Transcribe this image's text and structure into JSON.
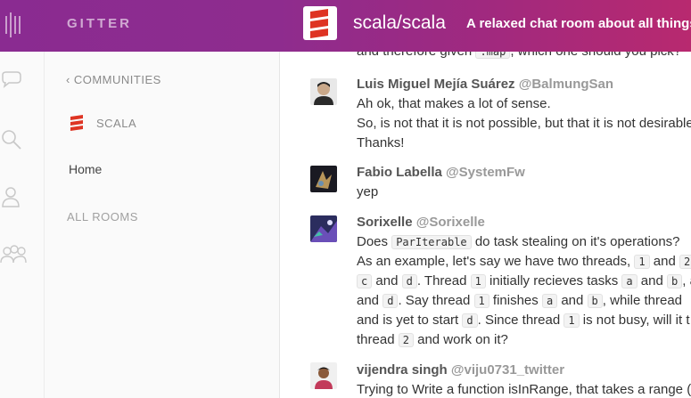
{
  "header": {
    "app_name": "GITTER",
    "room_name": "scala/scala",
    "room_topic": "A relaxed chat room about all things S"
  },
  "panel": {
    "back_label": "COMMUNITIES",
    "community_name": "SCALA",
    "home_label": "Home",
    "all_rooms_label": "ALL ROOMS"
  },
  "messages": {
    "partial": {
      "text_a": "and therefore given ",
      "code": ".map",
      "text_b": ", which one should you pick?"
    },
    "m1": {
      "name": "Luis Miguel Mejía Suárez",
      "user": "@BalmungSan",
      "lines": [
        "Ah ok, that makes a lot of sense.",
        "So, is not that it is not possible, but that it is not desirable",
        "Thanks!"
      ]
    },
    "m2": {
      "name": "Fabio Labella",
      "user": "@SystemFw",
      "lines": [
        "yep"
      ]
    },
    "m3": {
      "name": "Sorixelle",
      "user": "@Sorixelle",
      "l1": {
        "a": "Does ",
        "c1": "ParIterable",
        "b": " do task stealing on it's operations?"
      },
      "l2": {
        "a": "As an example, let's say we have two threads, ",
        "c1": "1",
        "b": " and ",
        "c2": "2"
      },
      "l3": {
        "c1": "c",
        "a": " and ",
        "c2": "d",
        "b": ". Thread ",
        "c3": "1",
        "c": " initially recieves tasks ",
        "c4": "a",
        "d": " and ",
        "c5": "b",
        "e": ", a"
      },
      "l4": {
        "a": "and ",
        "c1": "d",
        "b": ". Say thread ",
        "c2": "1",
        "c": " finishes ",
        "c3": "a",
        "d": " and ",
        "c4": "b",
        "e": ", while thread "
      },
      "l5": {
        "a": "and is yet to start ",
        "c1": "d",
        "b": ". Since thread ",
        "c2": "1",
        "c": " is not busy, will it t"
      },
      "l6": {
        "a": "thread ",
        "c1": "2",
        "b": " and work on it?"
      }
    },
    "m4": {
      "name": "vijendra singh",
      "user": "@viju0731_twitter",
      "lines": [
        "Trying to Write a function isInRange, that takes a range (f"
      ]
    }
  },
  "colors": {
    "header_start": "#8a2b91",
    "header_end": "#b8296f",
    "scala_red": "#de3423"
  }
}
